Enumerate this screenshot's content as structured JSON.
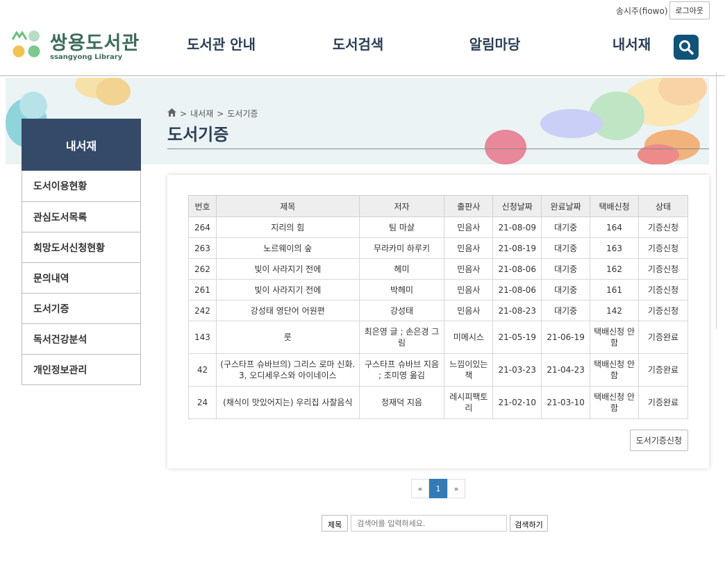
{
  "topbar": {
    "user": "송시주(fiowo)",
    "logout": "로그아웃"
  },
  "logo": {
    "ko": "쌍용도서관",
    "en": "ssangyong Library"
  },
  "gnb": [
    "도서관 안내",
    "도서검색",
    "알림마당",
    "내서재"
  ],
  "breadcrumb": {
    "sep": ">",
    "level1": "내서재",
    "level2": "도서기증"
  },
  "page_title": "도서기증",
  "sidebar": {
    "title": "내서재",
    "items": [
      "도서이용현황",
      "관심도서목록",
      "희망도서신청현황",
      "문의내역",
      "도서기증",
      "독서건강분석",
      "개인정보관리"
    ]
  },
  "table": {
    "headers": [
      "번호",
      "제목",
      "저자",
      "출판사",
      "신청날짜",
      "완료날짜",
      "택배신청",
      "상태"
    ],
    "rows": [
      [
        "264",
        "지리의 힘",
        "팀 마샬",
        "민음사",
        "21-08-09",
        "대기중",
        "164",
        "기증신청"
      ],
      [
        "263",
        "노르웨이의 숲",
        "무라카미 하루키",
        "민음사",
        "21-08-19",
        "대기중",
        "163",
        "기증신청"
      ],
      [
        "262",
        "빛이 사라지기 전에",
        "헤미",
        "민음사",
        "21-08-06",
        "대기중",
        "162",
        "기증신청"
      ],
      [
        "261",
        "빛이 사라지기 전에",
        "박헤미",
        "민음사",
        "21-08-06",
        "대기중",
        "161",
        "기증신청"
      ],
      [
        "242",
        "강성태 영단어 어원편",
        "강성태",
        "민음사",
        "21-08-23",
        "대기중",
        "142",
        "기증신청"
      ],
      [
        "143",
        "룻",
        "최은영 글 ; 손은경 그림",
        "미메시스",
        "21-05-19",
        "21-06-19",
        "택배신청 안함",
        "기증완료"
      ],
      [
        "42",
        "(구스타프 슈바브의) 그리스 로마 신화. 3, 오디세우스와 아이네이스",
        "구스타프 슈바브 지음 ; 조미영 옮김",
        "느낌이있는책",
        "21-03-23",
        "21-04-23",
        "택배신청 안함",
        "기증완료"
      ],
      [
        "24",
        "(채식이 맛있어지는) 우리집 사찰음식",
        "정재덕 지음",
        "레시피팩토리",
        "21-02-10",
        "21-03-10",
        "택배신청 안함",
        "기증완료"
      ]
    ]
  },
  "apply_button": "도서기증신청",
  "pager": {
    "prev": "«",
    "current": "1",
    "next": "»"
  },
  "search": {
    "field": "제목",
    "placeholder": "검색어를 입력하세요.",
    "button": "검색하기"
  }
}
